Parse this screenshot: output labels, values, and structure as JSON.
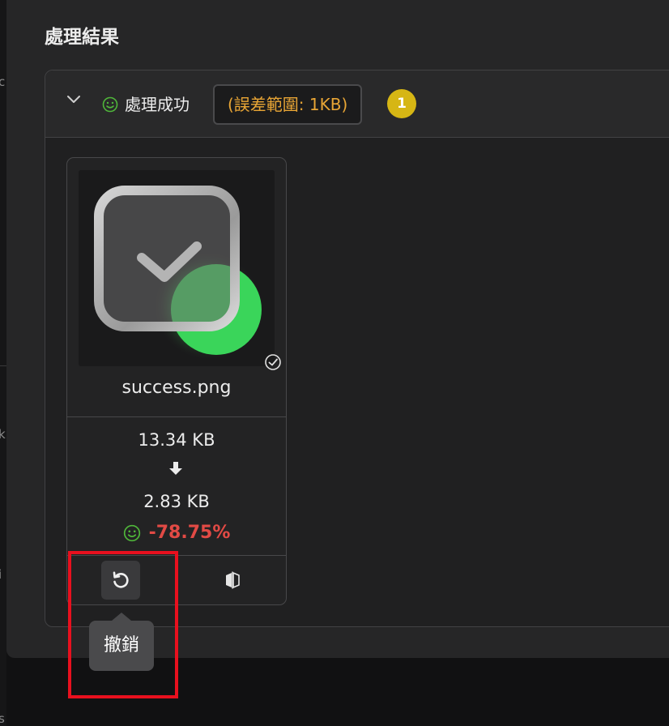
{
  "page": {
    "title": "處理結果"
  },
  "edge": {
    "glyphs": [
      "c",
      "k",
      "i",
      "s"
    ]
  },
  "group": {
    "status_label": "處理成功",
    "tolerance_tag": "(誤差範圍: 1KB)",
    "count": "1",
    "icons": {
      "collapse": "chevron-down-icon",
      "status": "smile-icon"
    }
  },
  "card": {
    "file_name": "success.png",
    "original_size": "13.34 KB",
    "compressed_size": "2.83 KB",
    "ratio": "-78.75%",
    "icons": {
      "thumbnail": "checkmark-app-icon",
      "done": "check-circle-icon",
      "arrow": "arrow-down-icon",
      "result": "smile-icon",
      "undo": "undo-icon",
      "compare": "compare-icon"
    }
  },
  "tooltip": {
    "text": "撤銷"
  },
  "colors": {
    "panel_bg": "#262627",
    "success_green": "#4fb63a",
    "warning_orange": "#e8a535",
    "badge_yellow": "#d6b614",
    "ratio_red": "#e24a45",
    "highlight_red": "#e8101e"
  }
}
